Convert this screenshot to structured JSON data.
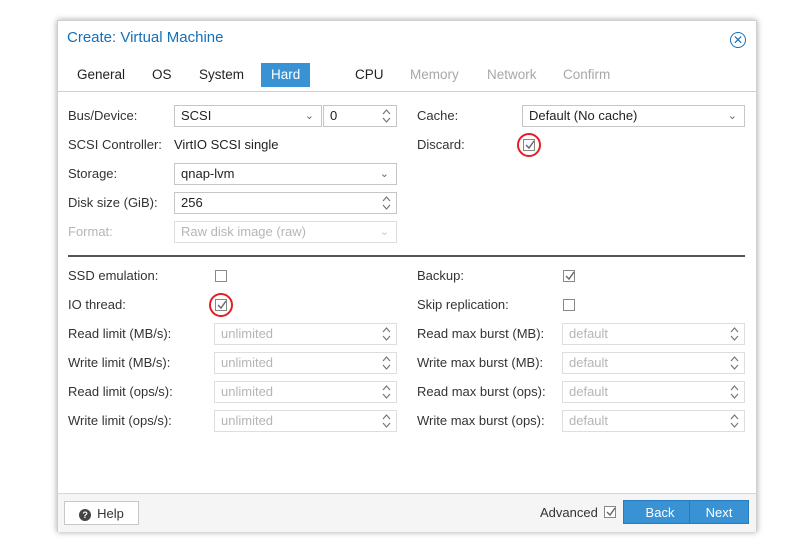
{
  "dialog": {
    "title": "Create: Virtual Machine"
  },
  "tabs": [
    {
      "label": "General",
      "state": "normal"
    },
    {
      "label": "OS",
      "state": "normal"
    },
    {
      "label": "System",
      "state": "normal"
    },
    {
      "label": "Hard Disk",
      "state": "active"
    },
    {
      "label": "CPU",
      "state": "normal"
    },
    {
      "label": "Memory",
      "state": "disabled"
    },
    {
      "label": "Network",
      "state": "disabled"
    },
    {
      "label": "Confirm",
      "state": "disabled"
    }
  ],
  "disk": {
    "bus_label": "Bus/Device:",
    "bus_value": "SCSI",
    "device_value": "0",
    "controller_label": "SCSI Controller:",
    "controller_value": "VirtIO SCSI single",
    "storage_label": "Storage:",
    "storage_value": "qnap-lvm",
    "size_label": "Disk size (GiB):",
    "size_value": "256",
    "format_label": "Format:",
    "format_value": "Raw disk image (raw)",
    "cache_label": "Cache:",
    "cache_value": "Default (No cache)",
    "discard_label": "Discard:",
    "discard_checked": true
  },
  "advanced": {
    "ssd_label": "SSD emulation:",
    "ssd_checked": false,
    "iothread_label": "IO thread:",
    "iothread_checked": true,
    "read_limit_label": "Read limit (MB/s):",
    "write_limit_label": "Write limit (MB/s):",
    "read_ops_label": "Read limit (ops/s):",
    "write_ops_label": "Write limit (ops/s):",
    "limit_placeholder": "unlimited",
    "backup_label": "Backup:",
    "backup_checked": true,
    "skip_repl_label": "Skip replication:",
    "skip_repl_checked": false,
    "read_burst_label": "Read max burst (MB):",
    "write_burst_label": "Write max burst (MB):",
    "read_ops_burst_label": "Read max burst (ops):",
    "write_ops_burst_label": "Write max burst (ops):",
    "burst_placeholder": "default"
  },
  "footer": {
    "help_label": "Help",
    "advanced_label": "Advanced",
    "advanced_checked": true,
    "back_label": "Back",
    "next_label": "Next"
  },
  "colors": {
    "accent": "#3892d4",
    "title": "#1570b8",
    "highlight": "#e31e24"
  }
}
